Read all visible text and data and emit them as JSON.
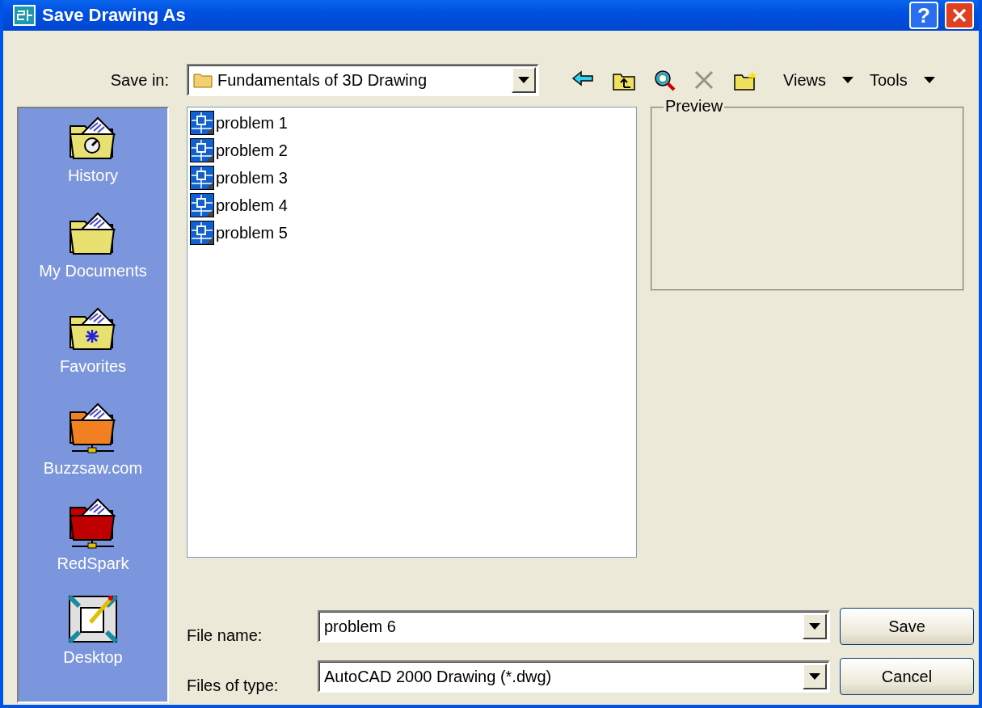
{
  "window": {
    "title": "Save Drawing As",
    "help_button": "?"
  },
  "save_in": {
    "label": "Save in:",
    "value": "Fundamentals of 3D Drawing"
  },
  "toolbar": [
    {
      "kind": "back",
      "disabled": false
    },
    {
      "kind": "up",
      "disabled": false
    },
    {
      "kind": "search-web",
      "disabled": false
    },
    {
      "kind": "delete",
      "disabled": true
    },
    {
      "kind": "new-folder",
      "disabled": false
    }
  ],
  "menus": [
    "Views",
    "Tools"
  ],
  "places": [
    {
      "label": "History",
      "kind": "history",
      "color": "#e8e070"
    },
    {
      "label": "My Documents",
      "kind": "folder",
      "color": "#e8e070"
    },
    {
      "label": "Favorites",
      "kind": "favorites",
      "color": "#e8e070"
    },
    {
      "label": "Buzzsaw.com",
      "kind": "network",
      "color": "#f08020"
    },
    {
      "label": "RedSpark",
      "kind": "network",
      "color": "#c00000"
    },
    {
      "label": "Desktop",
      "kind": "desktop"
    }
  ],
  "files": [
    {
      "name": "problem 1",
      "selected": false
    },
    {
      "name": "problem 2",
      "selected": false
    },
    {
      "name": "problem 3",
      "selected": false
    },
    {
      "name": "problem 4",
      "selected": false
    },
    {
      "name": "problem 5",
      "selected": false
    }
  ],
  "preview": {
    "label": "Preview"
  },
  "file_name": {
    "label": "File name:",
    "value": "problem 6"
  },
  "file_type": {
    "label": "Files of type:",
    "value": "AutoCAD 2000 Drawing (*.dwg)"
  },
  "buttons": [
    "Save",
    "Cancel"
  ]
}
